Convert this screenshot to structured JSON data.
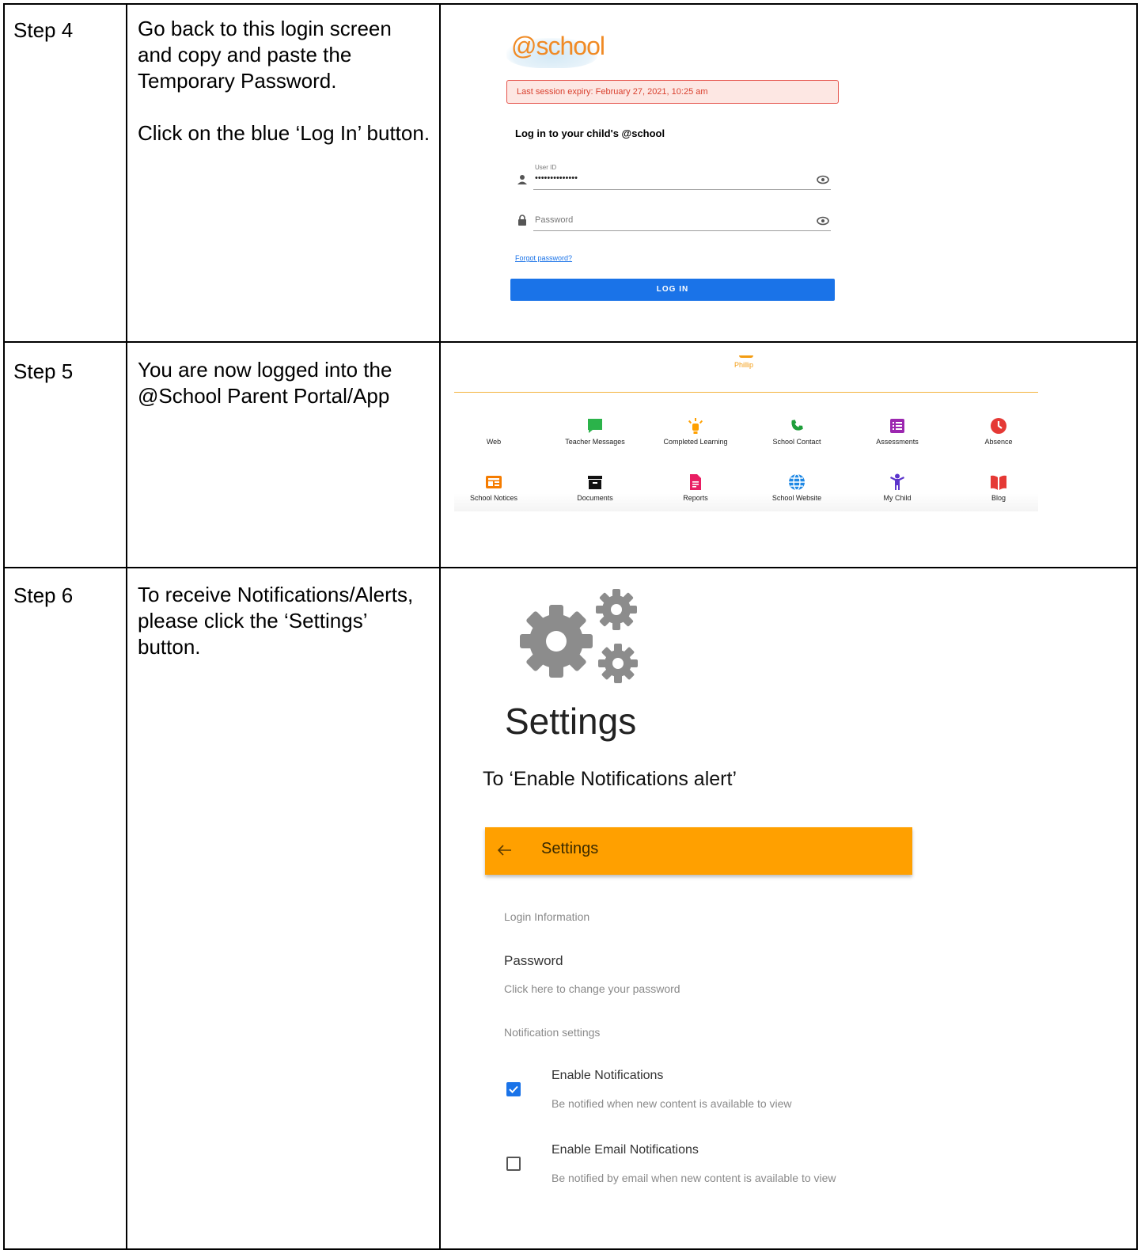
{
  "rows": [
    {
      "step": "Step 4",
      "instructions": [
        "Go back to this login screen and copy and paste the Temporary Password.",
        "Click on the blue ‘Log In’ button."
      ]
    },
    {
      "step": "Step 5",
      "instructions": [
        "You are now logged into the @School Parent Portal/App"
      ]
    },
    {
      "step": "Step 6",
      "instructions": [
        "To receive Notifications/Alerts, please click the ‘Settings’ button."
      ]
    }
  ],
  "login": {
    "logo_text": "@school",
    "alert": "Last session expiry: February 27, 2021, 10:25 am",
    "title": "Log in to your child's @school",
    "user_label": "User ID",
    "user_value": "••••••••••••••",
    "password_placeholder": "Password",
    "forgot": "Forgot password?",
    "login_button": "LOG IN"
  },
  "dashboard": {
    "child_name": "Phillip",
    "tiles": [
      {
        "label": "Web",
        "icon": "web-icon",
        "color": "#9e9e9e"
      },
      {
        "label": "Teacher Messages",
        "icon": "chat-icon",
        "color": "#2bb34a"
      },
      {
        "label": "Completed Learning",
        "icon": "lightbulb-icon",
        "color": "#ffa000"
      },
      {
        "label": "School Contact",
        "icon": "phone-icon",
        "color": "#1e9e3a"
      },
      {
        "label": "Assessments",
        "icon": "list-icon",
        "color": "#9c27b0"
      },
      {
        "label": "Absence",
        "icon": "clock-icon",
        "color": "#e53935"
      },
      {
        "label": "School Notices",
        "icon": "notices-icon",
        "color": "#f57c00"
      },
      {
        "label": "Documents",
        "icon": "archive-icon",
        "color": "#111111"
      },
      {
        "label": "Reports",
        "icon": "report-icon",
        "color": "#e91e63"
      },
      {
        "label": "School Website",
        "icon": "globe-icon",
        "color": "#1e88e5"
      },
      {
        "label": "My Child",
        "icon": "child-icon",
        "color": "#5c35cc"
      },
      {
        "label": "Blog",
        "icon": "book-icon",
        "color": "#e53935"
      }
    ]
  },
  "settings": {
    "heading": "Settings",
    "caption": "To ‘Enable Notifications alert’",
    "bar_title": "Settings",
    "login_info": "Login Information",
    "password_title": "Password",
    "password_sub": "Click here to change your password",
    "notif_settings": "Notification settings",
    "enable_notif": {
      "title": "Enable Notifications",
      "desc": "Be notified when new content is available to view",
      "checked": true
    },
    "enable_email": {
      "title": "Enable Email Notifications",
      "desc": "Be notified by email when new content is available to view",
      "checked": false
    }
  }
}
